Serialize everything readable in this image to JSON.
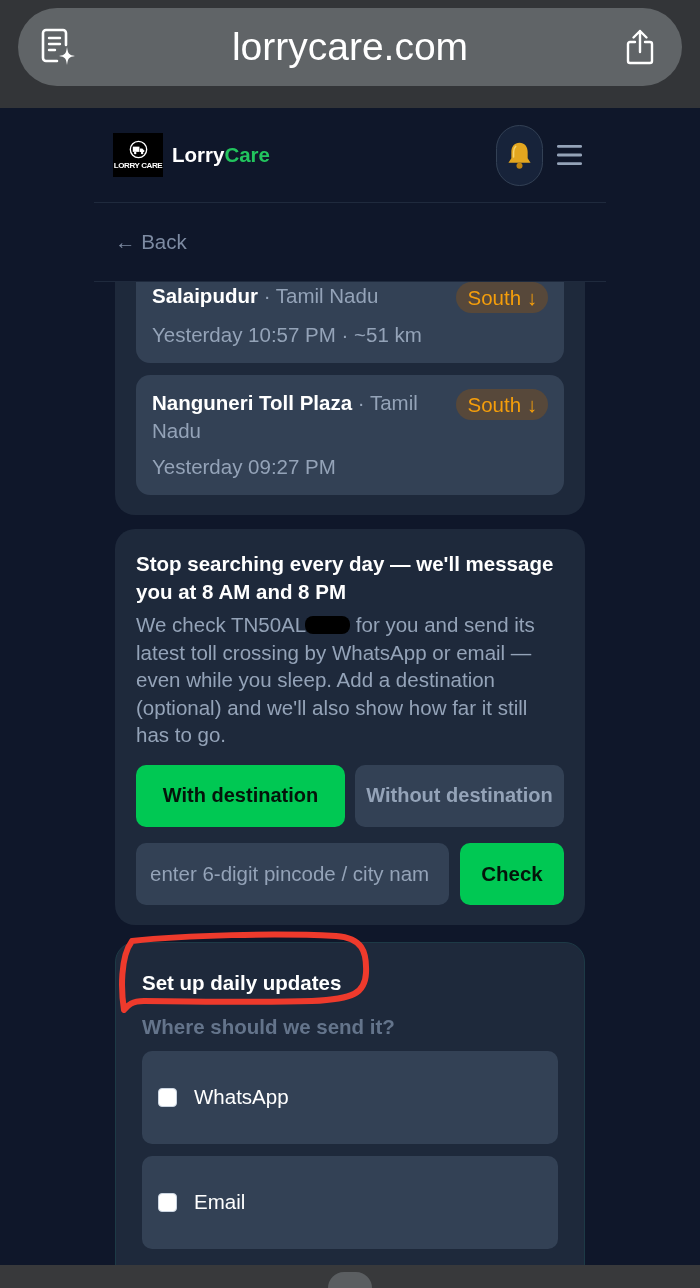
{
  "browser": {
    "url": "lorrycare.com"
  },
  "header": {
    "logo_text": "LORRY CARE",
    "brand": [
      {
        "text": "Lorry",
        "accent": false
      },
      {
        "text": "Care",
        "accent": true
      }
    ]
  },
  "back_link": "← Back",
  "crossings": [
    {
      "location": "**Salaipudur** · Tamil Nadu",
      "direction": "South ↓",
      "time": "Yesterday 10:57 PM · ~51 km"
    },
    {
      "location": "**Nanguneri Toll Plaza** · Tamil Nadu",
      "direction": "South ↓",
      "time": "Yesterday 09:27 PM"
    }
  ],
  "subscribe": {
    "title": "Stop searching every day — we'll message you at 8 AM and 8 PM",
    "description": {
      "before": "We check TN50AL",
      "redacted": true,
      "after": " for you and send its latest toll crossing by WhatsApp or email — even while you sleep. Add a destination (optional) and we'll also show how far it still has to go."
    },
    "modes": [
      {
        "label": "With destination",
        "selected": true
      },
      {
        "label": "Without destination",
        "selected": false
      }
    ],
    "destination_field": {
      "placeholder": "enter 6-digit pincode / city nam"
    },
    "check_button": "Check"
  },
  "daily_updates": {
    "title": "Set up daily updates",
    "title_circled": true,
    "prompt": "Where should we send it?",
    "channels": [
      {
        "label": "WhatsApp",
        "checked": false
      },
      {
        "label": "Email",
        "checked": false
      }
    ]
  }
}
